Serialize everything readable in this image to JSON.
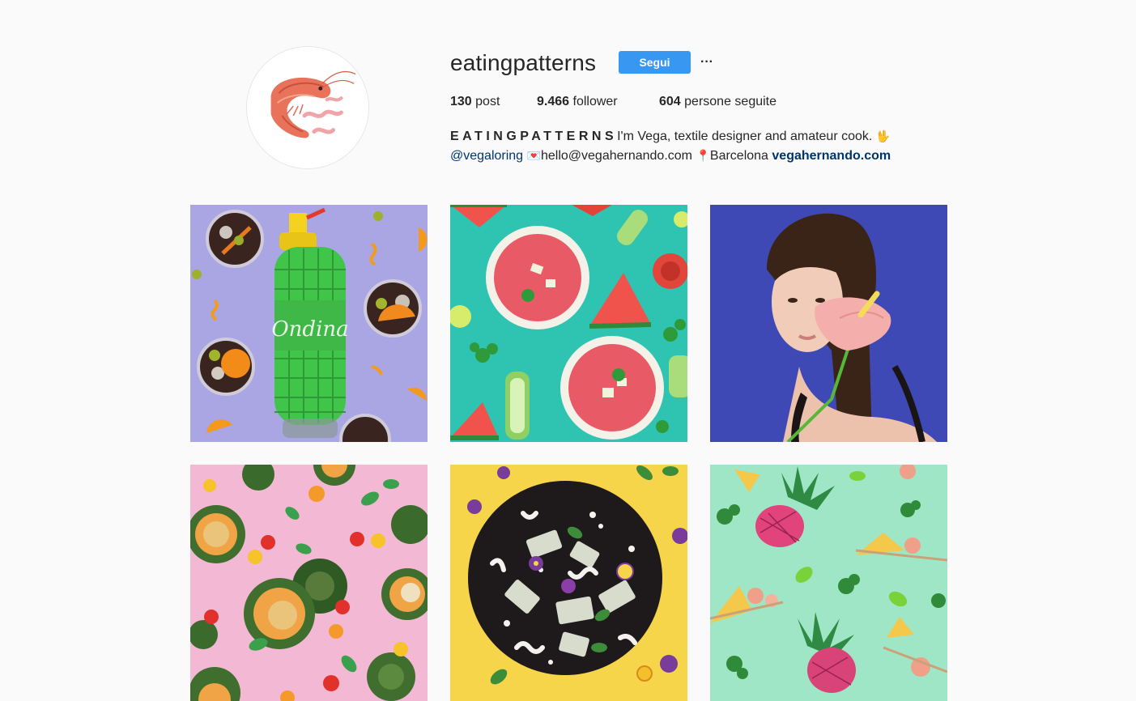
{
  "profile": {
    "username": "eatingpatterns",
    "follow_label": "Segui",
    "more_label": "···",
    "avatar": "shrimp-avatar-image"
  },
  "stats": {
    "posts_count": "130",
    "posts_label": "post",
    "followers_count": "9.466",
    "followers_label": "follower",
    "following_count": "604",
    "following_label": "persone seguite"
  },
  "bio": {
    "name": "EATINGPATTERNS",
    "text": "I'm Vega, textile designer and amateur cook.",
    "emoji_hand": "🖖",
    "mention": "@vegaloring",
    "emoji_mail": "💌",
    "email": "hello@vegahernando.com",
    "emoji_pin": "📍",
    "location": "Barcelona",
    "website": "vegahernando.com"
  },
  "colors": {
    "accent": "#3897f0",
    "link": "#003569",
    "background": "#fafafa"
  },
  "posts": [
    {
      "id": "post-1",
      "subject": "soda-siphon-vermouth-image"
    },
    {
      "id": "post-2",
      "subject": "gazpacho-watermelon-image"
    },
    {
      "id": "post-3",
      "subject": "woman-anthurium-portrait-image"
    },
    {
      "id": "post-4",
      "subject": "stuffed-zucchini-pink-image"
    },
    {
      "id": "post-5",
      "subject": "black-plate-flowers-image"
    },
    {
      "id": "post-6",
      "subject": "pineapple-skewers-mint-image"
    }
  ]
}
